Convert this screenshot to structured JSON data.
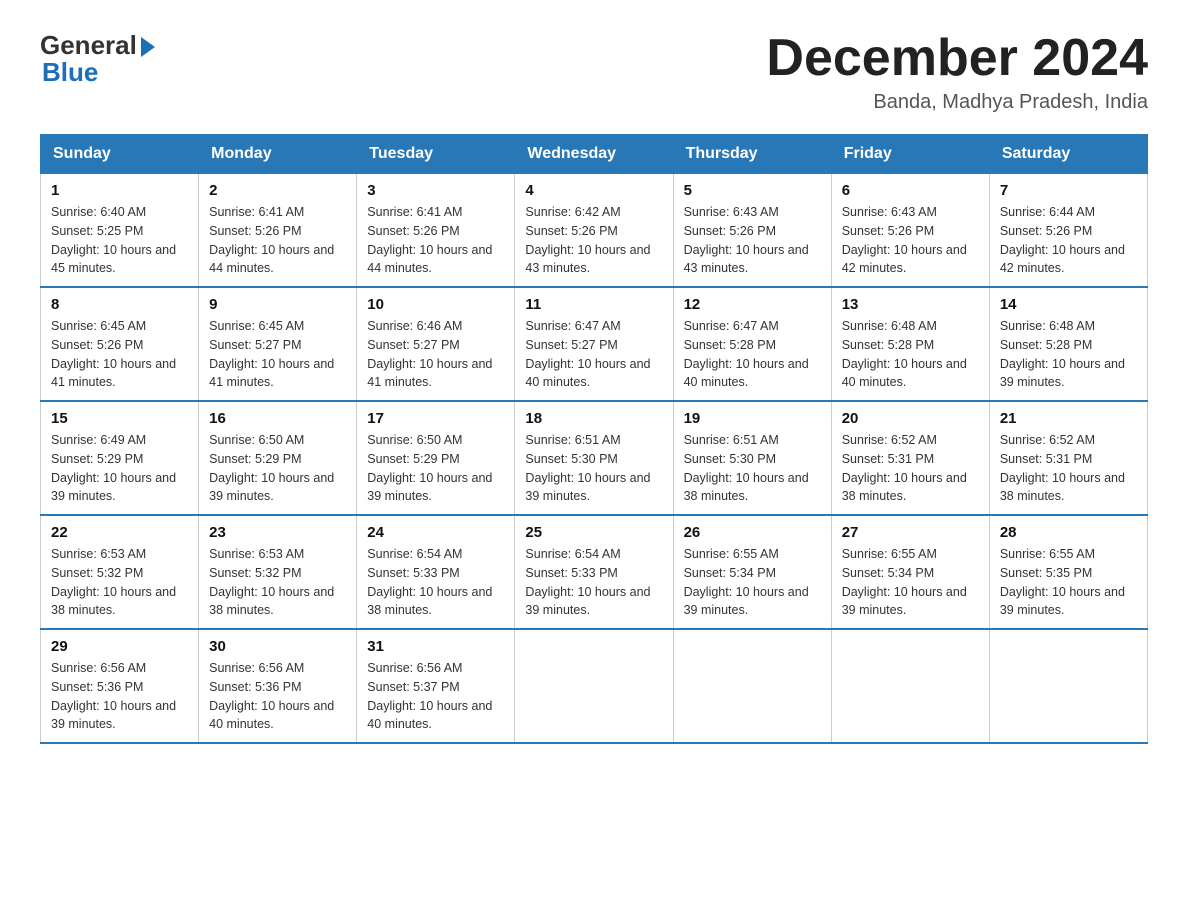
{
  "header": {
    "logo_general": "General",
    "logo_blue": "Blue",
    "month_title": "December 2024",
    "location": "Banda, Madhya Pradesh, India"
  },
  "weekdays": [
    "Sunday",
    "Monday",
    "Tuesday",
    "Wednesday",
    "Thursday",
    "Friday",
    "Saturday"
  ],
  "weeks": [
    [
      {
        "day": "1",
        "sunrise": "6:40 AM",
        "sunset": "5:25 PM",
        "daylight": "10 hours and 45 minutes."
      },
      {
        "day": "2",
        "sunrise": "6:41 AM",
        "sunset": "5:26 PM",
        "daylight": "10 hours and 44 minutes."
      },
      {
        "day": "3",
        "sunrise": "6:41 AM",
        "sunset": "5:26 PM",
        "daylight": "10 hours and 44 minutes."
      },
      {
        "day": "4",
        "sunrise": "6:42 AM",
        "sunset": "5:26 PM",
        "daylight": "10 hours and 43 minutes."
      },
      {
        "day": "5",
        "sunrise": "6:43 AM",
        "sunset": "5:26 PM",
        "daylight": "10 hours and 43 minutes."
      },
      {
        "day": "6",
        "sunrise": "6:43 AM",
        "sunset": "5:26 PM",
        "daylight": "10 hours and 42 minutes."
      },
      {
        "day": "7",
        "sunrise": "6:44 AM",
        "sunset": "5:26 PM",
        "daylight": "10 hours and 42 minutes."
      }
    ],
    [
      {
        "day": "8",
        "sunrise": "6:45 AM",
        "sunset": "5:26 PM",
        "daylight": "10 hours and 41 minutes."
      },
      {
        "day": "9",
        "sunrise": "6:45 AM",
        "sunset": "5:27 PM",
        "daylight": "10 hours and 41 minutes."
      },
      {
        "day": "10",
        "sunrise": "6:46 AM",
        "sunset": "5:27 PM",
        "daylight": "10 hours and 41 minutes."
      },
      {
        "day": "11",
        "sunrise": "6:47 AM",
        "sunset": "5:27 PM",
        "daylight": "10 hours and 40 minutes."
      },
      {
        "day": "12",
        "sunrise": "6:47 AM",
        "sunset": "5:28 PM",
        "daylight": "10 hours and 40 minutes."
      },
      {
        "day": "13",
        "sunrise": "6:48 AM",
        "sunset": "5:28 PM",
        "daylight": "10 hours and 40 minutes."
      },
      {
        "day": "14",
        "sunrise": "6:48 AM",
        "sunset": "5:28 PM",
        "daylight": "10 hours and 39 minutes."
      }
    ],
    [
      {
        "day": "15",
        "sunrise": "6:49 AM",
        "sunset": "5:29 PM",
        "daylight": "10 hours and 39 minutes."
      },
      {
        "day": "16",
        "sunrise": "6:50 AM",
        "sunset": "5:29 PM",
        "daylight": "10 hours and 39 minutes."
      },
      {
        "day": "17",
        "sunrise": "6:50 AM",
        "sunset": "5:29 PM",
        "daylight": "10 hours and 39 minutes."
      },
      {
        "day": "18",
        "sunrise": "6:51 AM",
        "sunset": "5:30 PM",
        "daylight": "10 hours and 39 minutes."
      },
      {
        "day": "19",
        "sunrise": "6:51 AM",
        "sunset": "5:30 PM",
        "daylight": "10 hours and 38 minutes."
      },
      {
        "day": "20",
        "sunrise": "6:52 AM",
        "sunset": "5:31 PM",
        "daylight": "10 hours and 38 minutes."
      },
      {
        "day": "21",
        "sunrise": "6:52 AM",
        "sunset": "5:31 PM",
        "daylight": "10 hours and 38 minutes."
      }
    ],
    [
      {
        "day": "22",
        "sunrise": "6:53 AM",
        "sunset": "5:32 PM",
        "daylight": "10 hours and 38 minutes."
      },
      {
        "day": "23",
        "sunrise": "6:53 AM",
        "sunset": "5:32 PM",
        "daylight": "10 hours and 38 minutes."
      },
      {
        "day": "24",
        "sunrise": "6:54 AM",
        "sunset": "5:33 PM",
        "daylight": "10 hours and 38 minutes."
      },
      {
        "day": "25",
        "sunrise": "6:54 AM",
        "sunset": "5:33 PM",
        "daylight": "10 hours and 39 minutes."
      },
      {
        "day": "26",
        "sunrise": "6:55 AM",
        "sunset": "5:34 PM",
        "daylight": "10 hours and 39 minutes."
      },
      {
        "day": "27",
        "sunrise": "6:55 AM",
        "sunset": "5:34 PM",
        "daylight": "10 hours and 39 minutes."
      },
      {
        "day": "28",
        "sunrise": "6:55 AM",
        "sunset": "5:35 PM",
        "daylight": "10 hours and 39 minutes."
      }
    ],
    [
      {
        "day": "29",
        "sunrise": "6:56 AM",
        "sunset": "5:36 PM",
        "daylight": "10 hours and 39 minutes."
      },
      {
        "day": "30",
        "sunrise": "6:56 AM",
        "sunset": "5:36 PM",
        "daylight": "10 hours and 40 minutes."
      },
      {
        "day": "31",
        "sunrise": "6:56 AM",
        "sunset": "5:37 PM",
        "daylight": "10 hours and 40 minutes."
      },
      null,
      null,
      null,
      null
    ]
  ]
}
